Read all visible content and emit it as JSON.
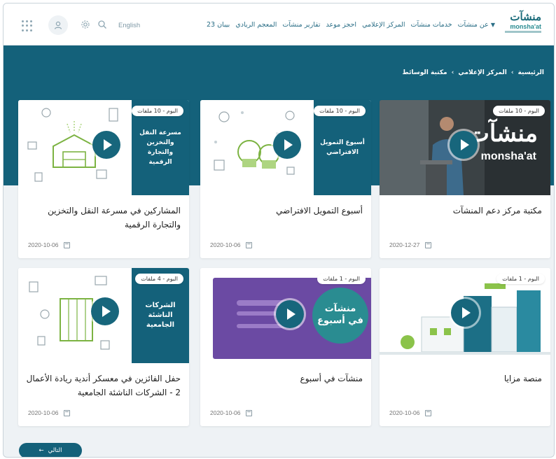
{
  "header": {
    "logo_arabic": "منشآت",
    "logo_english": "monsha'at",
    "nav": [
      {
        "label": "عن منشآت",
        "dropdown": true
      },
      {
        "label": "خدمات منشآت"
      },
      {
        "label": "المركز الإعلامي"
      },
      {
        "label": "احجز موعد"
      },
      {
        "label": "تقارير منشآت"
      },
      {
        "label": "المعجم الريادي"
      },
      {
        "label": "بيبان 23"
      }
    ],
    "language": "English",
    "icons": [
      "apps-grid-icon",
      "user-icon",
      "gear-icon",
      "search-icon"
    ]
  },
  "breadcrumb": [
    "الرئيسية",
    "المركز الإعلامي",
    "مكتبة الوسائط"
  ],
  "cards": [
    {
      "badge": "البوم - 10 ملفات",
      "title": "مكتبة مركز دعم المنشآت",
      "date": "2020-12-27",
      "panel": "",
      "thumb_logo_ar": "منشآت",
      "thumb_logo_en": "monsha'at"
    },
    {
      "badge": "البوم - 10 ملفات",
      "title": "أسبوع التمويل الافتراضي",
      "date": "2020-10-06",
      "panel": "أسبوع التمويل الافتراضي"
    },
    {
      "badge": "البوم - 10 ملفات",
      "title": "المشاركين في مسرعة النقل والتخزين والتجارة الرقمية",
      "date": "2020-10-06",
      "panel": "مسرعة النقل والتخزين والتجارة الرقمية"
    },
    {
      "badge": "البوم - 1 ملفات",
      "title": "منصة مزايا",
      "date": "2020-10-06",
      "panel": ""
    },
    {
      "badge": "البوم - 1 ملفات",
      "title": "منشآت في أسبوع",
      "date": "2020-10-06",
      "panel": "",
      "thumb_text": "منشآت في أسبوع"
    },
    {
      "badge": "البوم - 4 ملفات",
      "title": "حفل الفائزين في معسكر أندية ريادة الأعمال 2 - الشركات الناشئة الجامعية",
      "date": "2020-10-06",
      "panel": "الشركات الناشئة الجامعية"
    }
  ],
  "next_button": "التالي",
  "colors": {
    "brand": "#14617a",
    "background": "#eef2f5",
    "purple": "#6b4aa3",
    "green": "#8bc34a"
  }
}
